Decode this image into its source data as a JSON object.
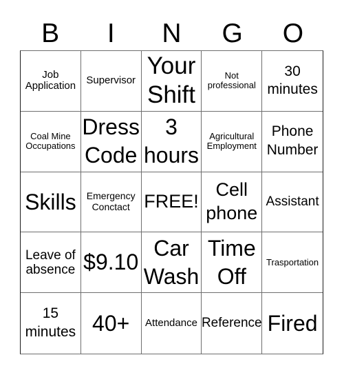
{
  "header": {
    "letters": [
      "B",
      "I",
      "N",
      "G",
      "O"
    ]
  },
  "cells": [
    {
      "text": "Job Application",
      "size": "s-md"
    },
    {
      "text": "Supervisor",
      "size": "s-md"
    },
    {
      "text": "Your Shift",
      "size": "s-huge"
    },
    {
      "text": "Not professional",
      "size": "s-xs"
    },
    {
      "text": "30 minutes",
      "size": "s-xl"
    },
    {
      "text": "Coal Mine Occupations",
      "size": "s-xs"
    },
    {
      "text": "Dress Code",
      "size": "s-big"
    },
    {
      "text": "3 hours",
      "size": "s-big"
    },
    {
      "text": "Agricultural Employment",
      "size": "s-xs"
    },
    {
      "text": "Phone Number",
      "size": "s-xl"
    },
    {
      "text": "Skills",
      "size": "s-big"
    },
    {
      "text": "Emergency Conctact",
      "size": "s-sm"
    },
    {
      "text": "FREE!",
      "size": "s-xxl"
    },
    {
      "text": "Cell phone",
      "size": "s-xxl"
    },
    {
      "text": "Assistant",
      "size": "s-lg"
    },
    {
      "text": "Leave of absence",
      "size": "s-lg"
    },
    {
      "text": "$9.10",
      "size": "s-big"
    },
    {
      "text": "Car Wash",
      "size": "s-big"
    },
    {
      "text": "Time Off",
      "size": "s-big"
    },
    {
      "text": "Trasportation",
      "size": "s-xs"
    },
    {
      "text": "15 minutes",
      "size": "s-xl"
    },
    {
      "text": "40+",
      "size": "s-big"
    },
    {
      "text": "Attendance",
      "size": "s-md"
    },
    {
      "text": "Reference",
      "size": "s-lg"
    },
    {
      "text": "Fired",
      "size": "s-big"
    }
  ]
}
